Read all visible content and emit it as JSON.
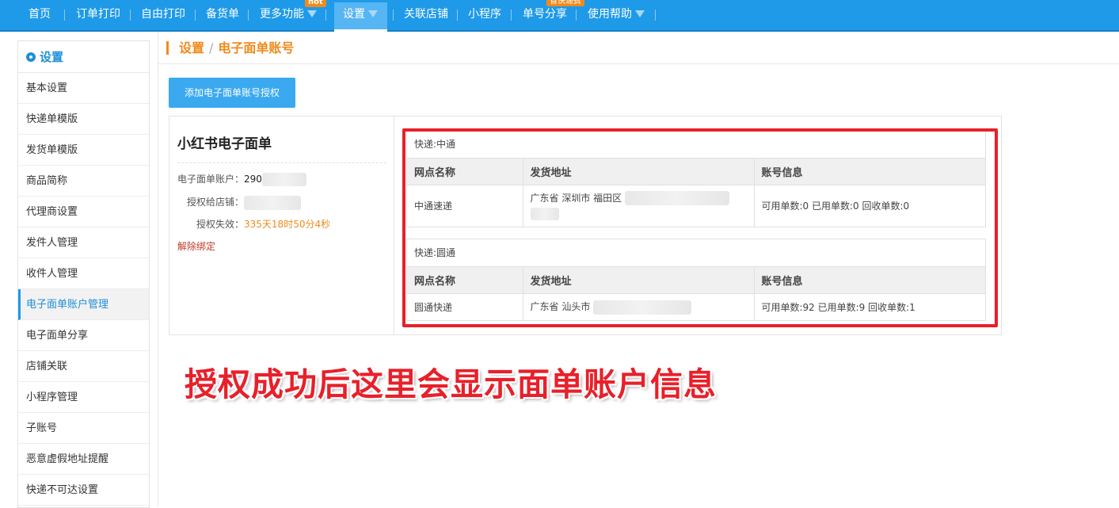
{
  "nav": {
    "items": [
      "首页",
      "订单打印",
      "自由打印",
      "备货单",
      "更多功能",
      "设置",
      "关联店铺",
      "小程序",
      "单号分享",
      "使用帮助"
    ],
    "badge_hot": "hot",
    "badge_shou": "省快递费"
  },
  "sidebar": {
    "title": "设置",
    "items": [
      "基本设置",
      "快递单模版",
      "发货单模版",
      "商品简称",
      "代理商设置",
      "发件人管理",
      "收件人管理",
      "电子面单账户管理",
      "电子面单分享",
      "店铺关联",
      "小程序管理",
      "子账号",
      "恶意虚假地址提醒",
      "快递不可达设置"
    ],
    "active_index": 7
  },
  "breadcrumb": {
    "parent": "设置",
    "sep": "/",
    "current": "电子面单账号"
  },
  "add_button": "添加电子面单账号授权",
  "card": {
    "title": "小红书电子面单",
    "account_label": "电子面单账户：",
    "account_value": "290",
    "shop_label": "授权给店铺：",
    "expire_label": "授权失效：",
    "expire_value": "335天18时50分4秒",
    "unbind": "解除绑定"
  },
  "tables": [
    {
      "caption": "快递:中通",
      "headers": [
        "网点名称",
        "发货地址",
        "账号信息"
      ],
      "row": {
        "name": "中通速递",
        "address": "广东省 深圳市 福田区",
        "info": "可用单数:0 已用单数:0 回收单数:0"
      }
    },
    {
      "caption": "快递:圆通",
      "headers": [
        "网点名称",
        "发货地址",
        "账号信息"
      ],
      "row": {
        "name": "圆通快递",
        "address": "广东省 汕头市",
        "info": "可用单数:92 已用单数:9 回收单数:1"
      }
    }
  ],
  "annotation": "授权成功后这里会显示面单账户信息",
  "colors": {
    "nav": "#1e9ae8",
    "accent": "#f08a1c",
    "highlight": "#e8202a"
  }
}
